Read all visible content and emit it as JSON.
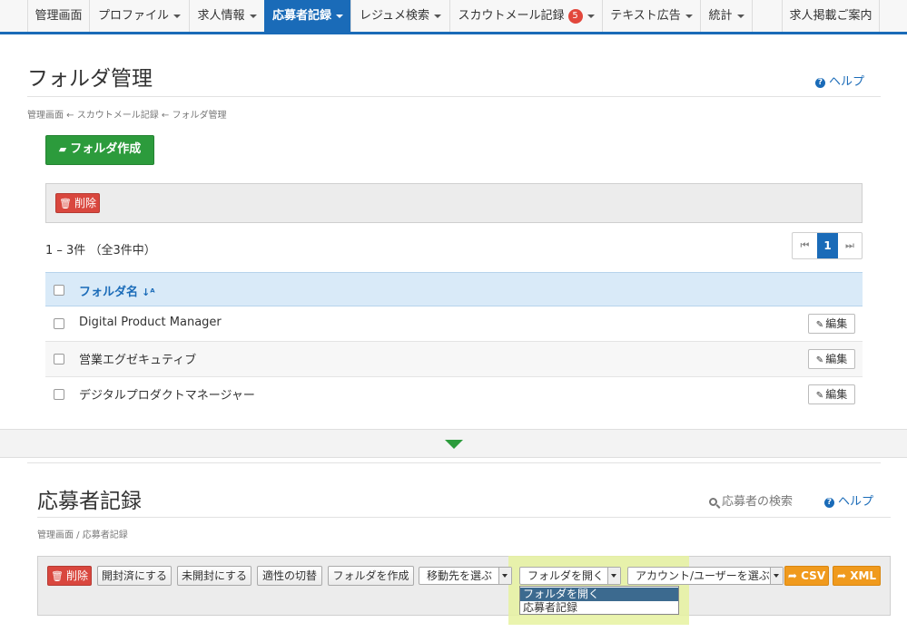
{
  "nav": {
    "items": [
      {
        "label": "管理画面"
      },
      {
        "label": "プロファイル"
      },
      {
        "label": "求人情報"
      },
      {
        "label": "応募者記録"
      },
      {
        "label": "レジュメ検索"
      },
      {
        "label": "スカウトメール記録",
        "badge": "5"
      },
      {
        "label": "テキスト広告"
      },
      {
        "label": "統計"
      },
      {
        "label": "求人掲載ご案内"
      }
    ]
  },
  "folder_page": {
    "title": "フォルダ管理",
    "help": "ヘルプ",
    "breadcrumb": "管理画面 ← スカウトメール記録 ← フォルダ管理",
    "create_button": "フォルダ作成",
    "delete_button": "削除",
    "result_count": "1 – 3件 （全3件中）",
    "pager": {
      "first": "⏮",
      "current": "1",
      "last": "⏭"
    },
    "table": {
      "column_header": "フォルダ名",
      "rows": [
        {
          "name": "Digital Product Manager",
          "edit": "編集"
        },
        {
          "name": "営業エグゼキュティブ",
          "edit": "編集"
        },
        {
          "name": "デジタルプロダクトマネージャー",
          "edit": "編集"
        }
      ]
    }
  },
  "applicant_page": {
    "title": "応募者記録",
    "search_link": "応募者の検索",
    "help": "ヘルプ",
    "breadcrumb": "管理画面 / 応募者記録",
    "toolbar": {
      "delete": "削除",
      "mark_opened": "開封済にする",
      "mark_unopened": "未開封にする",
      "toggle_fit": "適性の切替",
      "create_folder": "フォルダを作成",
      "move_select": "移動先を選ぶ",
      "open_folder_select": "フォルダを開く",
      "account_select": "アカウント/ユーザーを選ぶ",
      "csv": "CSV",
      "xml": "XML"
    },
    "dropdown_options": [
      "フォルダを開く",
      "応募者記録"
    ]
  },
  "colors": {
    "brand_blue": "#1a6bb8",
    "green": "#2c9b3c",
    "red": "#d9473e",
    "orange": "#f09a1d",
    "badge_red": "#e2473c"
  }
}
